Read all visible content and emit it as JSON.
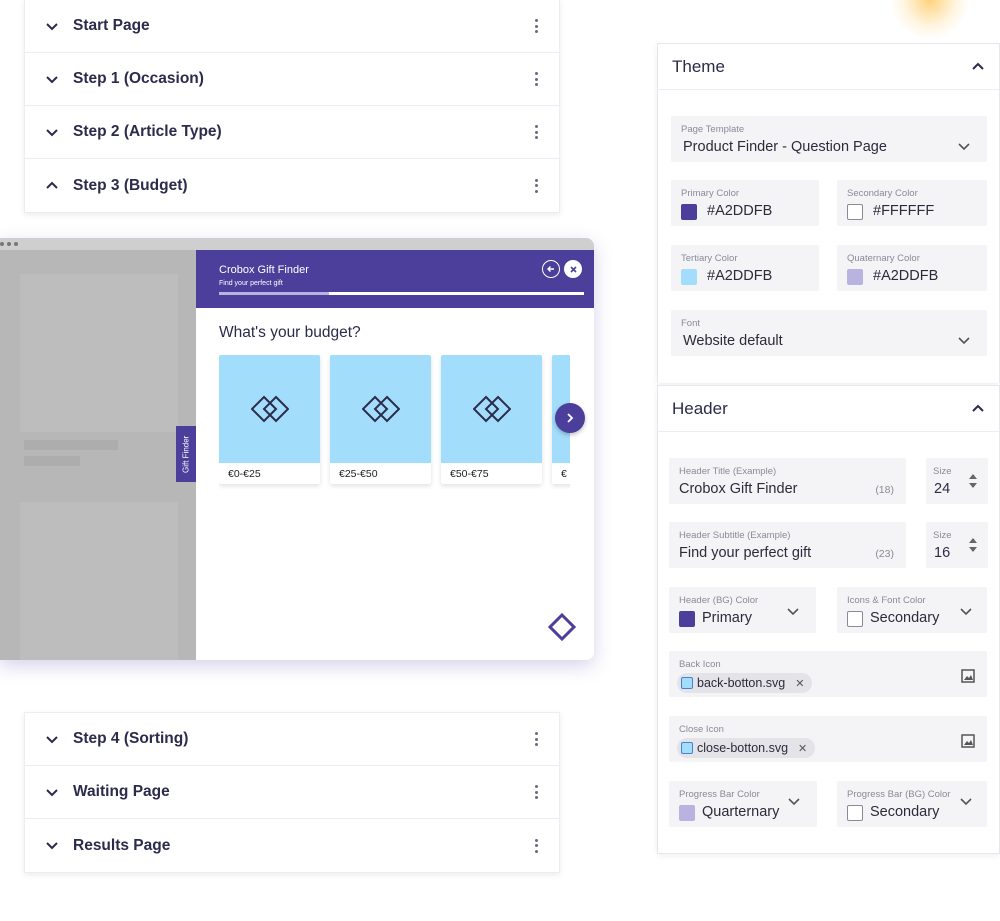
{
  "steps_top": [
    {
      "label": "Start Page",
      "expanded": false
    },
    {
      "label": "Step 1 (Occasion)",
      "expanded": false
    },
    {
      "label": "Step 2 (Article Type)",
      "expanded": false
    },
    {
      "label": "Step 3 (Budget)",
      "expanded": true
    }
  ],
  "steps_bottom": [
    {
      "label": "Step 4 (Sorting)",
      "expanded": false
    },
    {
      "label": "Waiting Page",
      "expanded": false
    },
    {
      "label": "Results Page",
      "expanded": false
    }
  ],
  "preview": {
    "side_tab": "Gift Finder",
    "header_title": "Crobox Gift Finder",
    "header_subtitle": "Find your perfect gift",
    "progress": 0.3,
    "question": "What's your budget?",
    "options": [
      "€0-€25",
      "€25-€50",
      "€50-€75",
      "€"
    ]
  },
  "theme": {
    "title": "Theme",
    "page_template": {
      "label": "Page Template",
      "value": "Product Finder - Question Page"
    },
    "primary": {
      "label": "Primary Color",
      "value": "#A2DDFB",
      "swatch": "#4b3f9b"
    },
    "secondary": {
      "label": "Secondary Color",
      "value": "#FFFFFF",
      "swatch": "#ffffff"
    },
    "tertiary": {
      "label": "Tertiary Color",
      "value": "#A2DDFB",
      "swatch": "#a2ddfb"
    },
    "quaternary": {
      "label": "Quaternary Color",
      "value": "#A2DDFB",
      "swatch": "#b8b3df"
    },
    "font": {
      "label": "Font",
      "value": "Website default"
    }
  },
  "header": {
    "title": "Header",
    "header_title": {
      "label": "Header Title (Example)",
      "value": "Crobox Gift Finder",
      "count": "(18)"
    },
    "header_title_size": {
      "label": "Size",
      "value": "24"
    },
    "header_subtitle": {
      "label": "Header Subtitle (Example)",
      "value": "Find your perfect gift",
      "count": "(23)"
    },
    "header_subtitle_size": {
      "label": "Size",
      "value": "16"
    },
    "bg_color": {
      "label": "Header (BG) Color",
      "value": "Primary"
    },
    "icons_font_color": {
      "label": "Icons & Font Color",
      "value": "Secondary"
    },
    "back_icon": {
      "label": "Back Icon",
      "file": "back-botton.svg"
    },
    "close_icon": {
      "label": "Close Icon",
      "file": "close-botton.svg"
    },
    "progress_color": {
      "label": "Progress Bar Color",
      "value": "Quarternary"
    },
    "progress_bg_color": {
      "label": "Progress Bar (BG) Color",
      "value": "Secondary"
    }
  }
}
